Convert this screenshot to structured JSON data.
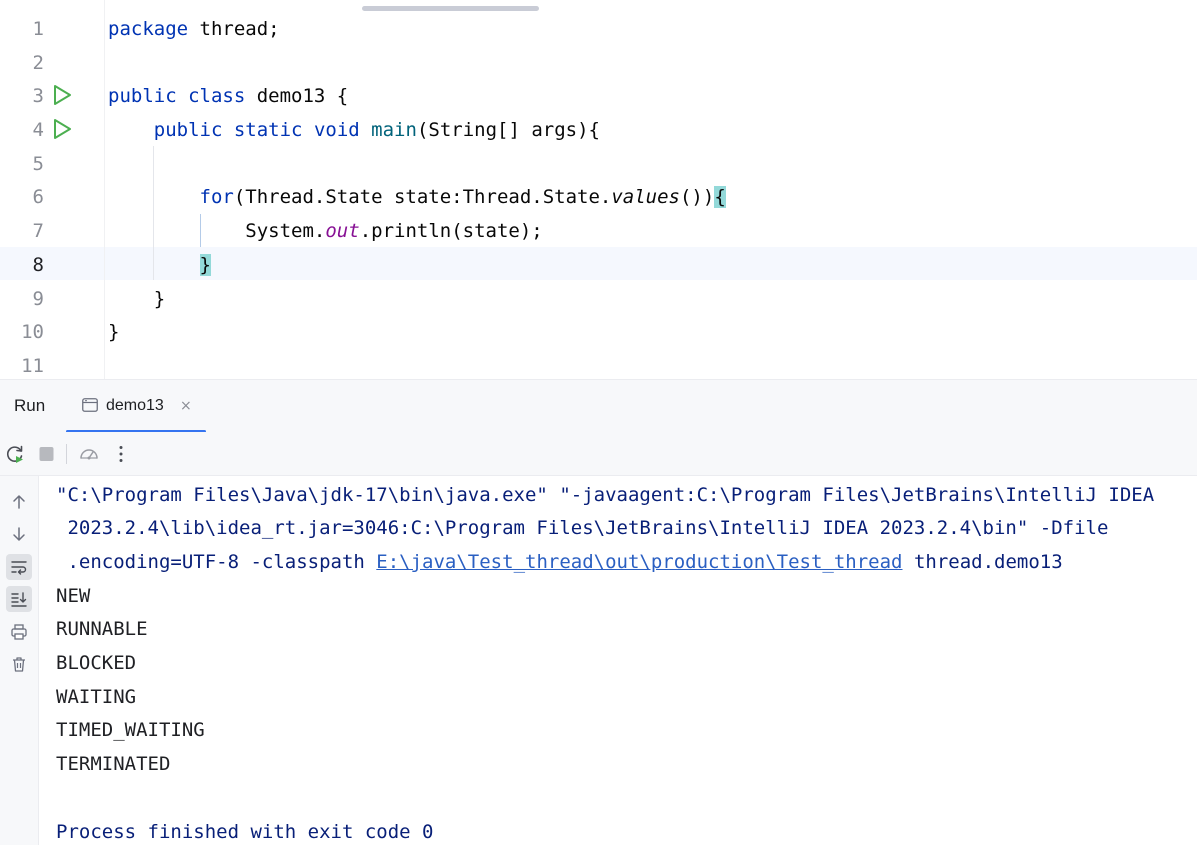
{
  "editor": {
    "lines": [
      {
        "n": "1",
        "kw1": "package",
        "rest": " thread;"
      },
      {
        "n": "2"
      },
      {
        "n": "3",
        "kw1": "public",
        "kw2": "class",
        "rest": " demo13 {"
      },
      {
        "n": "4",
        "indent": "    ",
        "kw1": "public",
        "kw2": "static",
        "kw3": "void",
        "fn": "main",
        "rest": "(String[] args){"
      },
      {
        "n": "5"
      },
      {
        "n": "6",
        "indent": "        ",
        "kw1": "for",
        "a": "(Thread.State state:Thread.State.",
        "it": "values",
        "b": "())",
        "brace": "{"
      },
      {
        "n": "7",
        "indent": "            ",
        "a": "System.",
        "st": "out",
        "b": ".println(state);"
      },
      {
        "n": "8",
        "indent": "        ",
        "brace": "}"
      },
      {
        "n": "9",
        "rest": "    }"
      },
      {
        "n": "10",
        "rest": "}"
      },
      {
        "n": "11"
      }
    ]
  },
  "run": {
    "title": "Run",
    "tab_label": "demo13",
    "tab_close": "×",
    "console": {
      "cmd1": "\"C:\\Program Files\\Java\\jdk-17\\bin\\java.exe\" \"-javaagent:C:\\Program Files\\JetBrains\\IntelliJ IDEA",
      "cmd2": " 2023.2.4\\lib\\idea_rt.jar=3046:C:\\Program Files\\JetBrains\\IntelliJ IDEA 2023.2.4\\bin\" -Dfile",
      "cmd3_pre": " .encoding=UTF-8 -classpath ",
      "cmd3_link": "E:\\java\\Test_thread\\out\\production\\Test_thread",
      "cmd3_post": " thread.demo13",
      "output": [
        "NEW",
        "RUNNABLE",
        "BLOCKED",
        "WAITING",
        "TIMED_WAITING",
        "TERMINATED"
      ],
      "finish": "Process finished with exit code 0"
    }
  },
  "icons": {
    "run_gutter": "run-triangle-icon",
    "tab": "console-tab-icon",
    "rerun": "rerun-icon",
    "stop": "stop-icon",
    "profiler": "speedometer-icon",
    "more": "more-vertical-icon",
    "up": "arrow-up-icon",
    "down": "arrow-down-icon",
    "wrap": "soft-wrap-icon",
    "scroll_end": "scroll-to-end-icon",
    "print": "printer-icon",
    "trash": "trash-icon"
  },
  "colors": {
    "keyword": "#0033b3",
    "function": "#00627a",
    "static_field": "#871094",
    "brace_match": "#93d9d9",
    "run_green": "#4caf50",
    "accent": "#3574f0",
    "console_cmd": "#081f78",
    "link": "#2a5fc2"
  }
}
